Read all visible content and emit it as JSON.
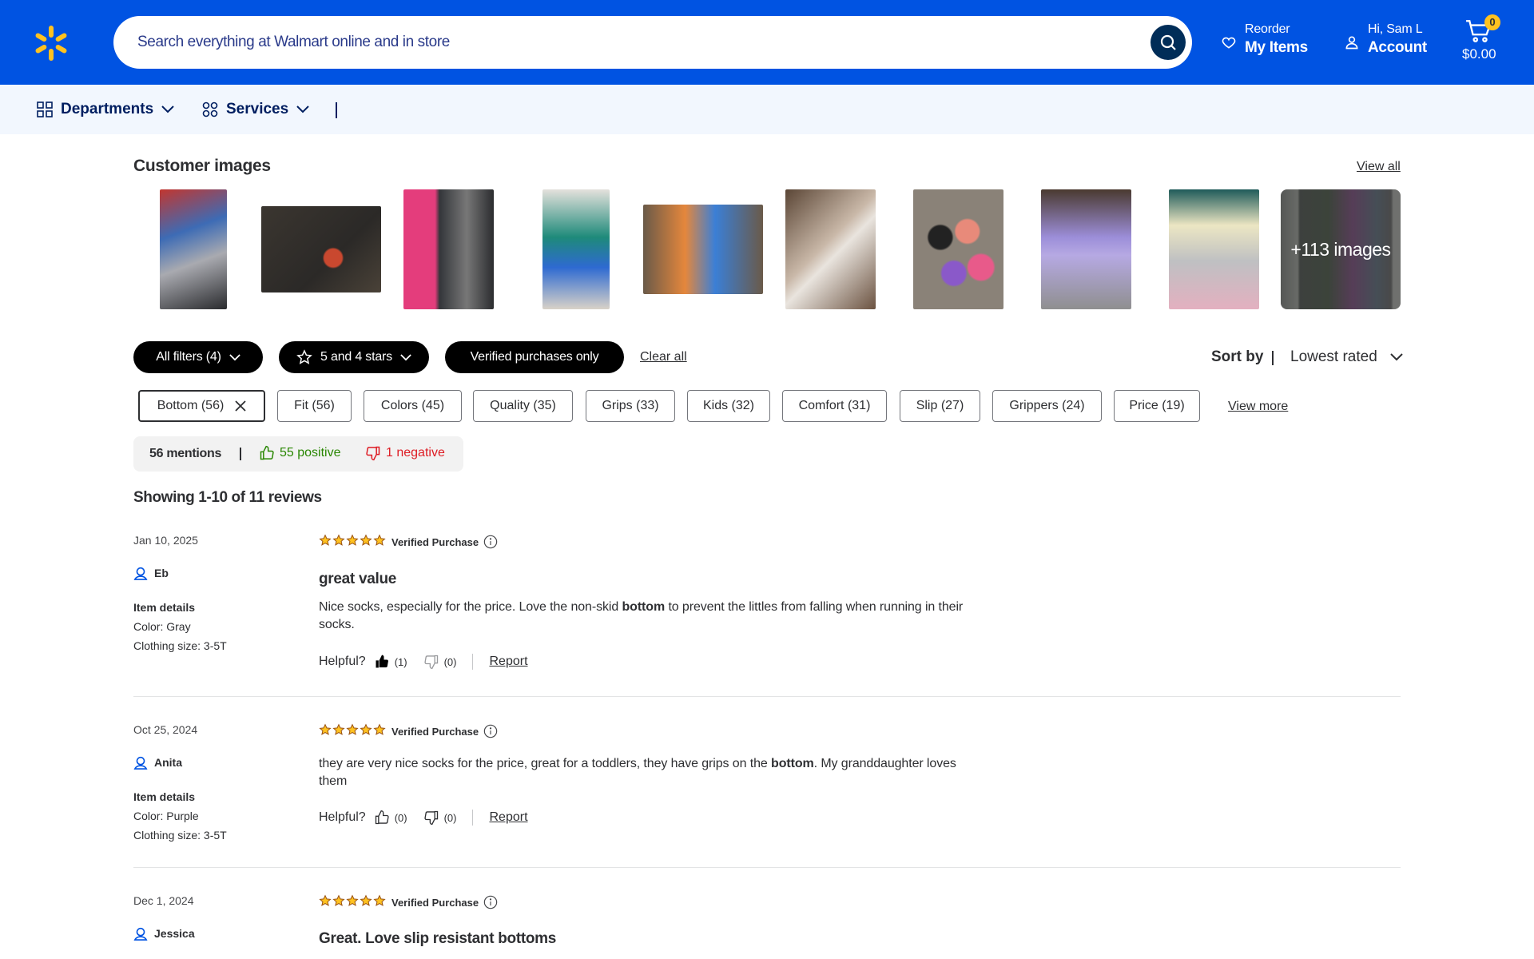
{
  "colors": {
    "brand_blue": "#0053e2",
    "spark_yellow": "#ffc220",
    "navy": "#001e60",
    "positive_green": "#2a8703",
    "negative_red": "#de1c24"
  },
  "header": {
    "search_placeholder": "Search everything at Walmart online and in store",
    "reorder_small": "Reorder",
    "reorder_big": "My Items",
    "account_small": "Hi, Sam L",
    "account_big": "Account",
    "cart_count": "0",
    "cart_total": "$0.00"
  },
  "subnav": {
    "departments": "Departments",
    "services": "Services"
  },
  "customer_images": {
    "title": "Customer images",
    "view_all": "View all",
    "more_label": "+113 images"
  },
  "filters": {
    "all_filters": "All filters (4)",
    "stars": "5 and 4 stars",
    "verified": "Verified purchases only",
    "clear_all": "Clear all",
    "sort_by": "Sort by",
    "sort_value": "Lowest rated"
  },
  "chips": [
    {
      "label": "Bottom (56)"
    },
    {
      "label": "Fit (56)"
    },
    {
      "label": "Colors (45)"
    },
    {
      "label": "Quality (35)"
    },
    {
      "label": "Grips (33)"
    },
    {
      "label": "Kids (32)"
    },
    {
      "label": "Comfort (31)"
    },
    {
      "label": "Slip (27)"
    },
    {
      "label": "Grippers (24)"
    },
    {
      "label": "Price (19)"
    }
  ],
  "view_more": "View more",
  "mentions": {
    "count": "56 mentions",
    "positive": "55 positive",
    "negative": "1 negative"
  },
  "showing": "Showing 1-10 of 11 reviews",
  "reviews": [
    {
      "date": "Jan 10, 2025",
      "rating": 5,
      "verified": "Verified Purchase",
      "user": "Eb",
      "details_heading": "Item details",
      "color": "Color: Gray",
      "size": "Clothing size: 3-5T",
      "title": "great value",
      "body_pre": "Nice socks, especially for the price. Love the non-skid ",
      "body_bold": "bottom",
      "body_post": " to prevent the littles from falling when running in their socks.",
      "helpful": "Helpful?",
      "up": "(1)",
      "down": "(0)",
      "report": "Report"
    },
    {
      "date": "Oct 25, 2024",
      "rating": 5,
      "verified": "Verified Purchase",
      "user": "Anita",
      "details_heading": "Item details",
      "color": "Color: Purple",
      "size": "Clothing size: 3-5T",
      "body_pre": "they are very nice socks for the price, great for a toddlers, they have grips on the ",
      "body_bold": "bottom",
      "body_post": ". My granddaughter loves them",
      "helpful": "Helpful?",
      "up": "(0)",
      "down": "(0)",
      "report": "Report"
    },
    {
      "date": "Dec 1, 2024",
      "rating": 5,
      "verified": "Verified Purchase",
      "user": "Jessica",
      "title": "Great. Love slip resistant bottoms"
    }
  ]
}
